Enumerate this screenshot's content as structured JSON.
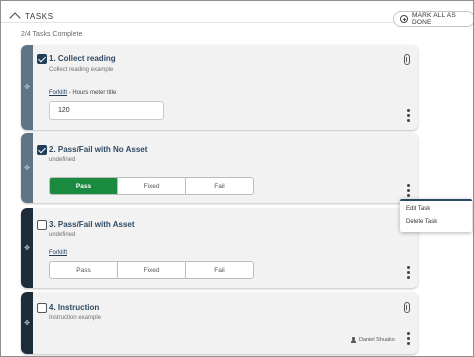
{
  "header": {
    "section_title": "TASKS",
    "mark_all_label": "MARK ALL AS DONE",
    "progress": "2/4 Tasks Complete"
  },
  "tasks": [
    {
      "title": "1. Collect reading",
      "subtitle": "Collect reading example",
      "checked": true,
      "asset_link": "Forklift",
      "asset_suffix": " - Hours meter title",
      "reading_value": "120"
    },
    {
      "title": "2. Pass/Fail with No Asset",
      "subtitle": "undefined",
      "checked": true,
      "options": [
        "Pass",
        "Fixed",
        "Fail"
      ],
      "selected": "Pass"
    },
    {
      "title": "3. Pass/Fail with Asset",
      "subtitle": "undefined",
      "checked": false,
      "asset_link": "Forklift",
      "options": [
        "Pass",
        "Fixed",
        "Fail"
      ],
      "selected": ""
    },
    {
      "title": "4. Instruction",
      "subtitle": "Instruction example",
      "checked": false,
      "author": "Daniel Shuako"
    }
  ],
  "context_menu": {
    "items": [
      "Edit Task",
      "Delete Task"
    ]
  },
  "icons": {
    "collapse": "chevron-up-icon",
    "mark_all": "plus-circle-icon",
    "drag": "drag-handle-icon",
    "attachment": "paperclip-icon",
    "more": "kebab-menu-icon",
    "author": "person-icon"
  },
  "colors": {
    "pass_active": "#1a8a3f",
    "completed_handle": "#5e7487",
    "pending_handle": "#1f2d3a",
    "title_text": "#2f4a62",
    "menu_accent": "#2a4a61"
  }
}
